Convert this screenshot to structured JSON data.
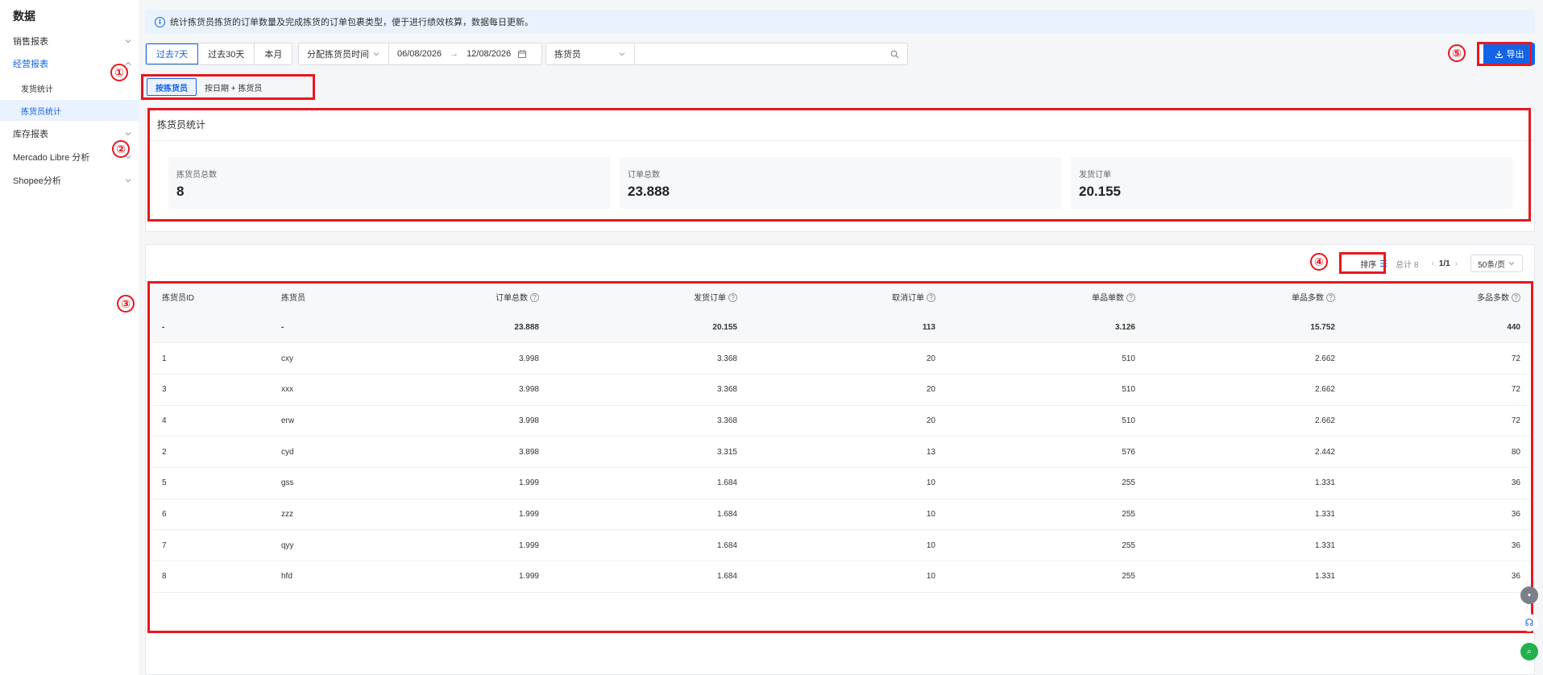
{
  "sidebar": {
    "title": "数据",
    "items": [
      {
        "label": "销售报表"
      },
      {
        "label": "经营报表"
      },
      {
        "label": "库存报表"
      },
      {
        "label": "Mercado Libre 分析"
      },
      {
        "label": "Shopee分析"
      }
    ],
    "subitems": [
      {
        "label": "发货统计"
      },
      {
        "label": "拣货员统计"
      }
    ]
  },
  "notice": {
    "text": "统计拣货员拣货的订单数量及完成拣货的订单包裹类型，便于进行绩效核算，数据每日更新。"
  },
  "toolbar": {
    "ranges": [
      "过去7天",
      "过去30天",
      "本月"
    ],
    "time_type": "分配拣货员时间",
    "date_start": "06/08/2026",
    "date_arrow": "→",
    "date_end": "12/08/2026",
    "picker_select": "拣货员",
    "search_value": "",
    "export_label": "导出"
  },
  "tabs": [
    "按拣货员",
    "按日期 + 拣货员"
  ],
  "stats": {
    "title": "拣货员统计",
    "cards": [
      {
        "label": "拣货员总数",
        "value": "8"
      },
      {
        "label": "订单总数",
        "value": "23.888"
      },
      {
        "label": "发货订单",
        "value": "20.155"
      }
    ]
  },
  "table_tools": {
    "sort_label": "排序",
    "total": "总计 8",
    "page": "1/1",
    "page_size": "50条/页"
  },
  "table": {
    "headers": [
      "拣货员ID",
      "拣货员",
      "订单总数",
      "发货订单",
      "取消订单",
      "单品单数",
      "单品多数",
      "多品多数"
    ],
    "help_mark": "?",
    "rows": [
      [
        "-",
        "-",
        "23.888",
        "20.155",
        "113",
        "3.126",
        "15.752",
        "440"
      ],
      [
        "1",
        "cxy",
        "3.998",
        "3.368",
        "20",
        "510",
        "2.662",
        "72"
      ],
      [
        "3",
        "xxx",
        "3.998",
        "3.368",
        "20",
        "510",
        "2.662",
        "72"
      ],
      [
        "4",
        "erw",
        "3.998",
        "3.368",
        "20",
        "510",
        "2.662",
        "72"
      ],
      [
        "2",
        "cyd",
        "3.898",
        "3.315",
        "13",
        "576",
        "2.442",
        "80"
      ],
      [
        "5",
        "gss",
        "1.999",
        "1.684",
        "10",
        "255",
        "1.331",
        "36"
      ],
      [
        "6",
        "zzz",
        "1.999",
        "1.684",
        "10",
        "255",
        "1.331",
        "36"
      ],
      [
        "7",
        "qyy",
        "1.999",
        "1.684",
        "10",
        "255",
        "1.331",
        "36"
      ],
      [
        "8",
        "hfd",
        "1.999",
        "1.684",
        "10",
        "255",
        "1.331",
        "36"
      ]
    ]
  },
  "annotations": [
    "①",
    "②",
    "③",
    "④",
    "⑤"
  ]
}
